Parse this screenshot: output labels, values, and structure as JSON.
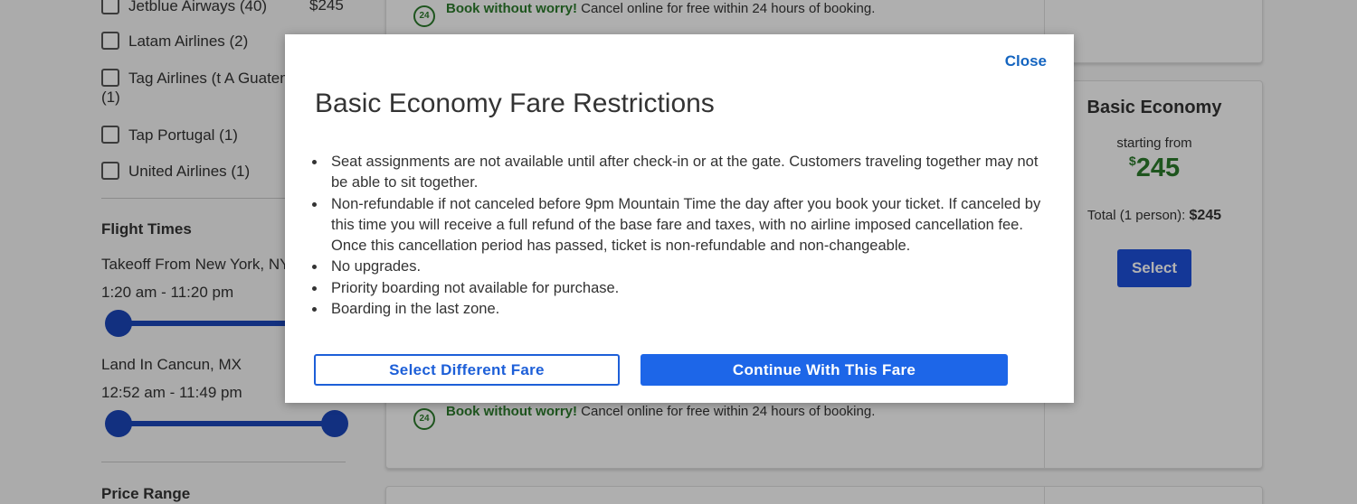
{
  "sidebar": {
    "airlines": [
      {
        "name": "Jetblue Airways (40)",
        "price": "$245"
      },
      {
        "name": "Latam Airlines (2)",
        "price": ""
      },
      {
        "name": "Tag Airlines (t A Guatemala",
        "count": "(1)"
      },
      {
        "name": "Tap Portugal (1)",
        "price": ""
      },
      {
        "name": "United Airlines (1)",
        "price": ""
      }
    ],
    "flight_times_heading": "Flight Times",
    "takeoff_label": "Takeoff From New York, NY",
    "takeoff_range": "1:20 am - 11:20 pm",
    "takeoff_slider": {
      "min_fraction": 0.0,
      "max_fraction": 1.0
    },
    "land_label": "Land In Cancun, MX",
    "land_range": "12:52 am - 11:49 pm",
    "land_slider": {
      "min_fraction": 0.0,
      "max_fraction": 1.0
    },
    "price_range_heading": "Price Range"
  },
  "results": {
    "worry_badge": "24",
    "worry_bold": "Book without worry!",
    "worry_text": " Cancel online for free within 24 hours of booking.",
    "fare": {
      "title": "Basic Economy",
      "from_label": "starting from",
      "currency": "$",
      "amount": "245",
      "total_label": "Total (1 person): ",
      "total_value": "$245",
      "select_label": "Select"
    }
  },
  "modal": {
    "close_label": "Close",
    "title": "Basic Economy Fare Restrictions",
    "rules": [
      "Seat assignments are not available until after check-in or at the gate. Customers traveling together may not be able to sit together.",
      "Non-refundable if not canceled before 9pm Mountain Time the day after you book your ticket. If canceled by this time you will receive a full refund of the base fare and taxes, with no airline imposed cancellation fee. Once this cancellation period has passed, ticket is non-refundable and non-changeable.",
      "No upgrades.",
      "Priority boarding not available for purchase.",
      "Boarding in the last zone."
    ],
    "secondary_button": "Select Different Fare",
    "primary_button": "Continue With This Fare"
  },
  "colors": {
    "primary_blue": "#1d66e8",
    "link_blue": "#1565c0",
    "price_green": "#2c7a2c",
    "slider_blue": "#1a45b8"
  }
}
